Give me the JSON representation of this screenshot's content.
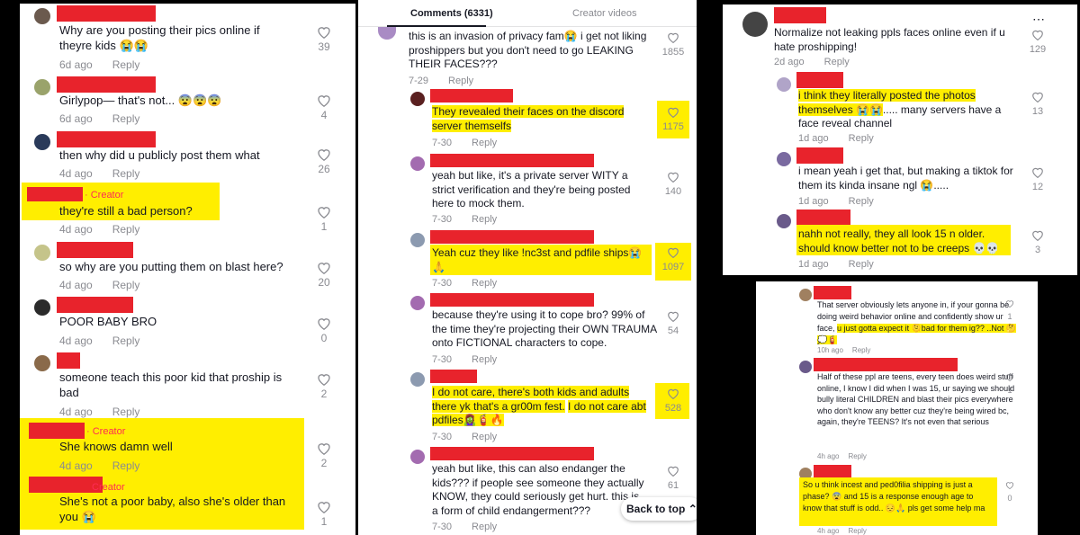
{
  "panel1": {
    "comments": [
      {
        "text": "Why are you posting their pics online if theyre kids 😭😭",
        "date": "6d ago",
        "likes": "39"
      },
      {
        "text": "Girlypop— that's not... 😨😨😨",
        "date": "6d ago",
        "likes": "4"
      },
      {
        "text": "then why did u publicly post them what",
        "date": "4d ago",
        "likes": "26"
      },
      {
        "creator": "· Creator",
        "text": "they're still a bad person?",
        "date": "4d ago",
        "likes": "1"
      },
      {
        "text": "so why are you putting them on blast here?",
        "date": "4d ago",
        "likes": "20"
      },
      {
        "text": "POOR BABY BRO",
        "date": "4d ago",
        "likes": "0"
      },
      {
        "text": "someone teach this poor kid that proship is bad",
        "date": "4d ago",
        "likes": "2"
      },
      {
        "creator": "· Creator",
        "text": "She knows damn well",
        "date": "4d ago",
        "likes": "2"
      },
      {
        "creator": "Creator",
        "text": "She's not a poor baby, also she's older than you 😭",
        "likes": "1"
      }
    ],
    "reply_label": "Reply"
  },
  "panel2": {
    "tab_comments": "Comments (6331)",
    "tab_creator": "Creator videos",
    "comments": [
      {
        "text": "this is an invasion of privacy fam😭 i get not liking proshippers but you don't need to go LEAKING THEIR FACES???",
        "date": "7-29",
        "likes": "1855"
      },
      {
        "text": "They revealed their faces on the discord server themselfs",
        "date": "7-30",
        "likes": "1175"
      },
      {
        "text": "yeah but like, it's a private server WITY a strict verification and they're being posted here to mock them.",
        "date": "7-30",
        "likes": "140"
      },
      {
        "text": "Yeah cuz they like !nc3st and pdfile ships😭🙏",
        "date": "7-30",
        "likes": "1097"
      },
      {
        "text": "because they're using it to cope bro? 99% of the time they're projecting their OWN TRAUMA onto FICTIONAL characters to cope.",
        "date": "7-30",
        "likes": "54"
      },
      {
        "text_a": "I do not care, there's both kids and adults there yk that's a gr00m fest.",
        "text_b": "I do not care abt pdfiles🧟‍♀️🧯🔥",
        "date": "7-30",
        "likes": "528"
      },
      {
        "text": "yeah but like, this can also endanger the kids??? if people see someone they actually KNOW, they could seriously get hurt. this is a form of child endangerment???",
        "date": "7-30",
        "likes": "61"
      }
    ],
    "reply_label": "Reply",
    "back_to_top": "Back to top"
  },
  "panel3": {
    "comments": [
      {
        "text": "Normalize not leaking ppls faces online even if u hate proshipping!",
        "date": "2d ago",
        "likes": "129"
      },
      {
        "text_hl": "i think they literally posted the photos themselves 😭😭",
        "text_rest": "..... many servers have a face reveal channel",
        "date": "1d ago",
        "likes": "13"
      },
      {
        "text": "i mean yeah i get that, but making a tiktok for them its kinda insane ngl 😭.....",
        "date": "1d ago",
        "likes": "12"
      },
      {
        "text": "nahh not really, they all look 15 n older. should know better not to be creeps 💀💀",
        "date": "1d ago",
        "likes": "3"
      }
    ],
    "reply_label": "Reply"
  },
  "panel4": {
    "comments": [
      {
        "text_a": "That server obviously lets anyone in, if your gonna be doing weird behavior online and confidently show ur face,",
        "text_b": "u just gotta expect it 🫠bad for them ig?? ..Not 🤔💭🧯",
        "date": "10h ago",
        "likes": "1"
      },
      {
        "text": "Half of these ppl are teens, every teen does weird stuff online, I know I did when I was 15, ur saying we should bully literal CHILDREN and blast their pics everywhere who don't know any better cuz they're being wired bc, again, they're TEENS? It's not even that serious",
        "date": "4h ago",
        "likes": "1"
      },
      {
        "text": "So u think incest and ped0filia shipping is just a phase? 😨 and 15 is a response enough age to know that stuff is odd.. 😔🙏 pls get some help ma",
        "date": "4h ago",
        "likes": "0"
      }
    ],
    "reply_label": "Reply"
  }
}
